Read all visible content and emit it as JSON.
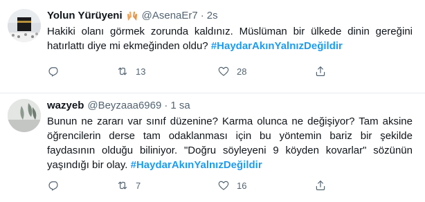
{
  "tweets": [
    {
      "name": "Yolun Yürüyeni",
      "handle": "@AsenaEr7",
      "separator": "·",
      "time": "2s",
      "body_text": "Hakiki olanı görmek zorunda kaldınız. Müslüman bir ülkede dinin gereğini hatırlattı diye mi ekmeğinden oldu? ",
      "hashtag": "#HaydarAkınYalnızDeğildir",
      "retweets": "13",
      "likes": "28"
    },
    {
      "name": "wazyeb",
      "handle": "@Beyzaaa6969",
      "separator": "·",
      "time": "1 sa",
      "body_text": "Bunun ne zararı var sınıf düzenine? Karma olunca ne değişiyor? Tam aksine öğrencilerin derse tam odaklanması için bu yöntemin bariz bir şekilde faydasının olduğu biliniyor. \"Doğru söyleyeni 9 köyden kovarlar\" sözünün yaşındığı bir olay. ",
      "hashtag": "#HaydarAkınYalnızDeğildir",
      "retweets": "7",
      "likes": "16"
    }
  ],
  "icons": [
    "reply-icon",
    "retweet-icon",
    "like-icon",
    "share-icon",
    "hands-emoji-icon"
  ],
  "colors": {
    "link": "#1d9bf0",
    "muted": "#536471",
    "text": "#0f1419",
    "divider": "#e6ecf0"
  }
}
